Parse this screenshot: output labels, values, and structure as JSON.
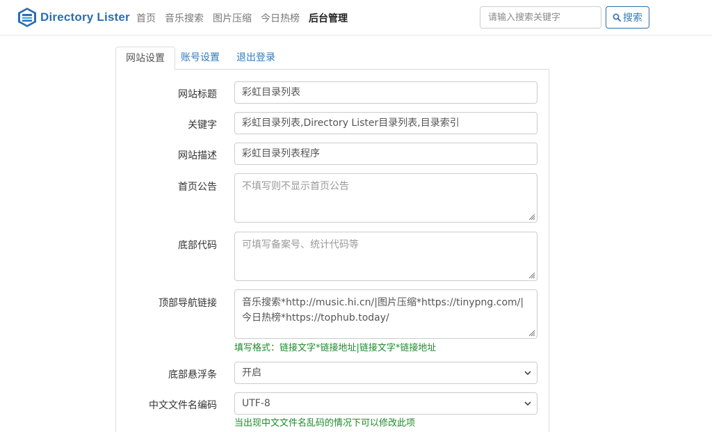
{
  "navbar": {
    "brand": "Directory Lister",
    "brand_color": "#2a6db4",
    "links": [
      "首页",
      "音乐搜索",
      "图片压缩",
      "今日热榜",
      "后台管理"
    ],
    "active_link": "后台管理",
    "search_placeholder": "请输入搜索关键字",
    "search_button": "搜索",
    "search_icon": "search-icon"
  },
  "tabs": [
    {
      "label": "网站设置",
      "active": true
    },
    {
      "label": "账号设置",
      "active": false
    },
    {
      "label": "退出登录",
      "active": false
    }
  ],
  "form": {
    "site_title": {
      "label": "网站标题",
      "value": "彩虹目录列表"
    },
    "keywords": {
      "label": "关键字",
      "value": "彩虹目录列表,Directory Lister目录列表,目录索引"
    },
    "description": {
      "label": "网站描述",
      "value": "彩虹目录列表程序"
    },
    "announcement": {
      "label": "首页公告",
      "value": "",
      "placeholder": "不填写则不显示首页公告"
    },
    "footer_code": {
      "label": "底部代码",
      "value": "",
      "placeholder": "可填写备案号、统计代码等"
    },
    "top_nav": {
      "label": "顶部导航链接",
      "value": "音乐搜索*http://music.hi.cn/|图片压缩*https://tinypng.com/|今日热榜*https://tophub.today/",
      "help": "填写格式：链接文字*链接地址|链接文字*链接地址"
    },
    "footer_bar": {
      "label": "底部悬浮条",
      "value": "开启"
    },
    "filename_encoding": {
      "label": "中文文件名编码",
      "value": "UTF-8",
      "help": "当出现中文文件名乱码的情况下可以修改此项"
    }
  },
  "colors": {
    "link": "#337ab7",
    "help_text": "#1d8a2a"
  }
}
